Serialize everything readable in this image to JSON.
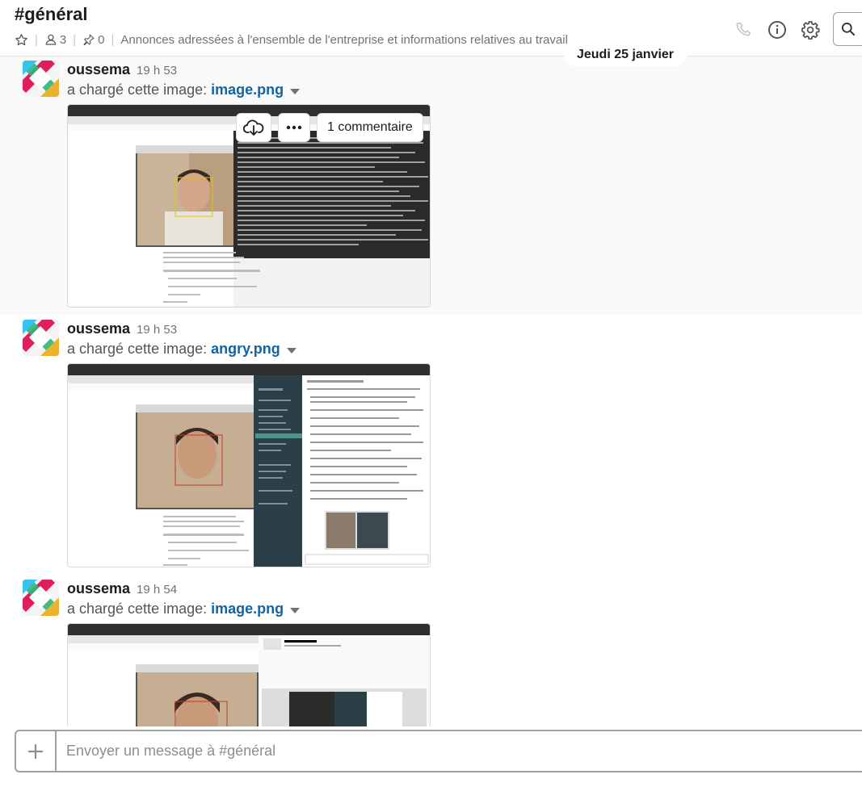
{
  "channel": {
    "title": "#général",
    "member_count": "3",
    "pinned_count": "0",
    "topic": "Annonces adressées à l'ensemble de l'entreprise et informations relatives au travail"
  },
  "header_icons": [
    "phone-icon",
    "info-icon",
    "gear-icon",
    "search-icon"
  ],
  "date_divider": "Jeudi 25 janvier",
  "messages": [
    {
      "author": "oussema",
      "time": "19 h 53",
      "action": "a chargé cette image:",
      "file": "image.png"
    },
    {
      "author": "oussema",
      "time": "19 h 53",
      "action": "a chargé cette image:",
      "file": "angry.png"
    },
    {
      "author": "oussema",
      "time": "19 h 54",
      "action": "a chargé cette image:",
      "file": "image.png"
    }
  ],
  "hover_actions": {
    "comments": "1 commentaire"
  },
  "composer": {
    "placeholder": "Envoyer un message à #général"
  },
  "colors": {
    "link": "#1264a3",
    "text": "#1d1c1d",
    "muted": "#717274",
    "terminal": "#2b2b2b",
    "slack_sidebar": "#2a3f47"
  }
}
